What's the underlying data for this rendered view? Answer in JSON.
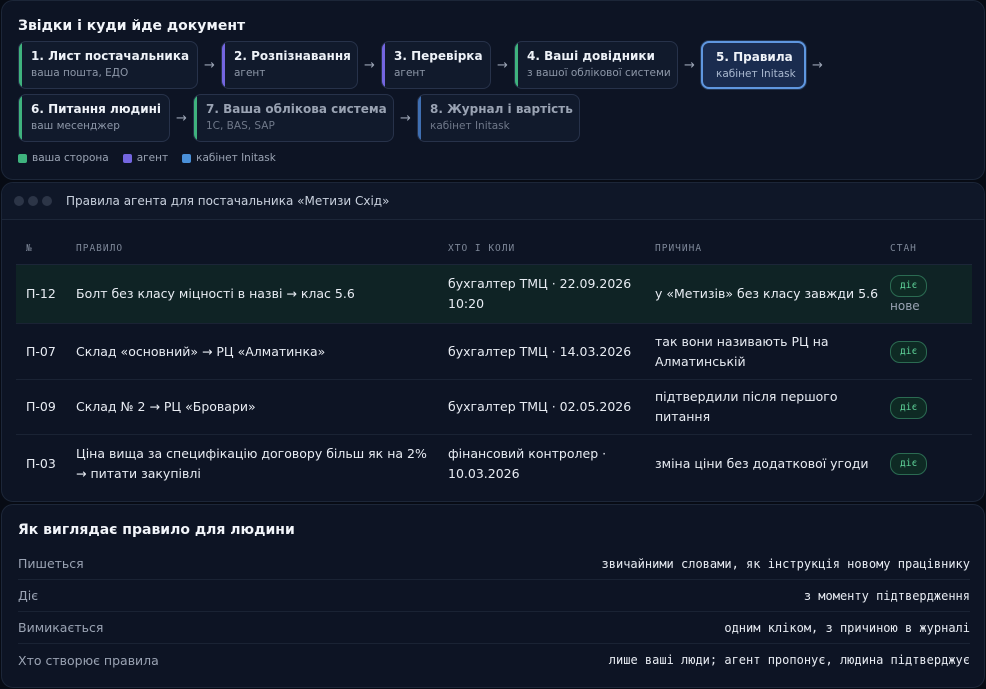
{
  "flow": {
    "title": "Звідки і куди йде документ",
    "steps": [
      {
        "title": "1. Лист постачальника",
        "sub": "ваша пошта, ЕДО"
      },
      {
        "title": "2. Розпізнавання",
        "sub": "агент"
      },
      {
        "title": "3. Перевірка",
        "sub": "агент"
      },
      {
        "title": "4. Ваші довідники",
        "sub": "з вашої облікової системи"
      },
      {
        "title": "5. Правила",
        "sub": "кабінет Initask"
      },
      {
        "title": "6. Питання людині",
        "sub": "ваш месенджер"
      },
      {
        "title": "7. Ваша облікова система",
        "sub": "1С, BAS, SAP"
      },
      {
        "title": "8. Журнал і вартість",
        "sub": "кабінет Initask"
      }
    ],
    "arrow": "→",
    "legend": [
      {
        "label": "ваша сторона",
        "color": "#3fb37e"
      },
      {
        "label": "агент",
        "color": "#7466e0"
      },
      {
        "label": "кабінет Initask",
        "color": "#4a90d9"
      }
    ]
  },
  "rules": {
    "window_title": "Правила агента для постачальника «Метизи Схід»",
    "columns": {
      "id": "№",
      "rule": "ПРАВИЛО",
      "who": "ХТО І КОЛИ",
      "why": "ПРИЧИНА",
      "state": "СТАН"
    },
    "rows": [
      {
        "id": "П-12",
        "rule": "Болт без класу міцності в назві → клас 5.6",
        "who": "бухгалтер ТМЦ · 22.09.2026 10:20",
        "why": "у «Метизів» без класу завжди 5.6",
        "state": "діє",
        "note": "нове"
      },
      {
        "id": "П-07",
        "rule": "Склад «основний» → РЦ «Алматинка»",
        "who": "бухгалтер ТМЦ · 14.03.2026",
        "why": "так вони називають РЦ на Алматинській",
        "state": "діє"
      },
      {
        "id": "П-09",
        "rule": "Склад № 2 → РЦ «Бровари»",
        "who": "бухгалтер ТМЦ · 02.05.2026",
        "why": "підтвердили після першого питання",
        "state": "діє"
      },
      {
        "id": "П-03",
        "rule": "Ціна вища за специфікацію договору більш як на 2% → питати закупівлі",
        "who": "фінансовий контролер · 10.03.2026",
        "why": "зміна ціни без додаткової угоди",
        "state": "діє"
      }
    ]
  },
  "human": {
    "title": "Як виглядає правило для людини",
    "rows": [
      {
        "k": "Пишеться",
        "v": "звичайними словами, як інструкція новому працівнику"
      },
      {
        "k": "Діє",
        "v": "з моменту підтвердження"
      },
      {
        "k": "Вимикається",
        "v": "одним кліком, з причиною в журналі"
      },
      {
        "k": "Хто створює правила",
        "v": "лише ваші люди; агент пропонує, людина підтверджує"
      }
    ]
  }
}
